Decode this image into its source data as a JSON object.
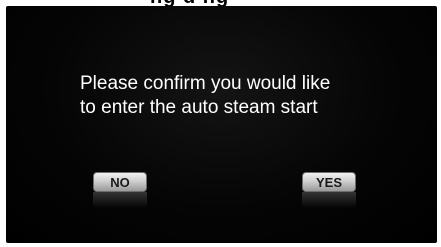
{
  "header": {
    "partial_text": "ng d ng"
  },
  "dialog": {
    "line1": "Please confirm you would like",
    "line2": "to enter the auto steam start"
  },
  "buttons": {
    "no_label": "NO",
    "yes_label": "YES"
  },
  "colors": {
    "screen_bg": "#000000",
    "text": "#ffffff",
    "button_face": "#cfcfcf"
  }
}
